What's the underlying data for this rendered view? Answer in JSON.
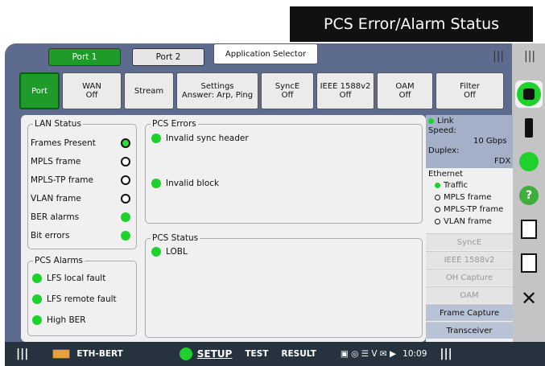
{
  "banner": {
    "title": "PCS Error/Alarm Status"
  },
  "ports": [
    {
      "label": "Port 1"
    },
    {
      "label": "Port 2"
    }
  ],
  "app_selector": "Application Selector",
  "nav": {
    "port": "Port",
    "wan": {
      "line1": "WAN",
      "line2": "Off"
    },
    "stream": "Stream",
    "settings": {
      "line1": "Settings",
      "line2": "Answer: Arp, Ping"
    },
    "synce": {
      "line1": "SyncE",
      "line2": "Off"
    },
    "ieee": {
      "line1": "IEEE 1588v2",
      "line2": "Off"
    },
    "oam": {
      "line1": "OAM",
      "line2": "Off"
    },
    "filter": {
      "line1": "Filter",
      "line2": "Off"
    }
  },
  "lan_status": {
    "title": "LAN Status",
    "items": [
      {
        "label": "Frames Present",
        "state": "ring-green"
      },
      {
        "label": "MPLS frame",
        "state": "ring"
      },
      {
        "label": "MPLS-TP frame",
        "state": "ring"
      },
      {
        "label": "VLAN frame",
        "state": "ring"
      },
      {
        "label": "BER alarms",
        "state": "green"
      },
      {
        "label": "Bit errors",
        "state": "green"
      }
    ]
  },
  "pcs_alarms": {
    "title": "PCS Alarms",
    "items": [
      {
        "label": "LFS local fault"
      },
      {
        "label": "LFS remote fault"
      },
      {
        "label": "High BER"
      }
    ]
  },
  "pcs_errors": {
    "title": "PCS Errors",
    "items": [
      {
        "label": "Invalid sync header"
      },
      {
        "label": "Invalid block"
      }
    ]
  },
  "pcs_status": {
    "title": "PCS Status",
    "items": [
      {
        "label": "LOBL"
      }
    ]
  },
  "link": {
    "title": "Link",
    "speed_label": "Speed:",
    "speed_value": "10 Gbps",
    "duplex_label": "Duplex:",
    "duplex_value": "FDX"
  },
  "ethernet": {
    "title": "Ethernet",
    "items": [
      {
        "label": "Traffic"
      },
      {
        "label": "MPLS frame"
      },
      {
        "label": "MPLS-TP frame"
      },
      {
        "label": "VLAN frame"
      }
    ]
  },
  "right_buttons": [
    {
      "label": "SyncE"
    },
    {
      "label": "IEEE 1588v2"
    },
    {
      "label": "OH Capture"
    },
    {
      "label": "OAM"
    },
    {
      "label": "Frame Capture"
    },
    {
      "label": "Transceiver"
    }
  ],
  "bottom": {
    "app_name": "ETH-BERT",
    "setup": "SETUP",
    "test": "TEST",
    "result": "RESULT",
    "time": "10:09"
  },
  "colors": {
    "accent_green": "#1f9b2a",
    "indicator_green": "#1fd12d",
    "frame_blue": "#5d6b8f"
  }
}
